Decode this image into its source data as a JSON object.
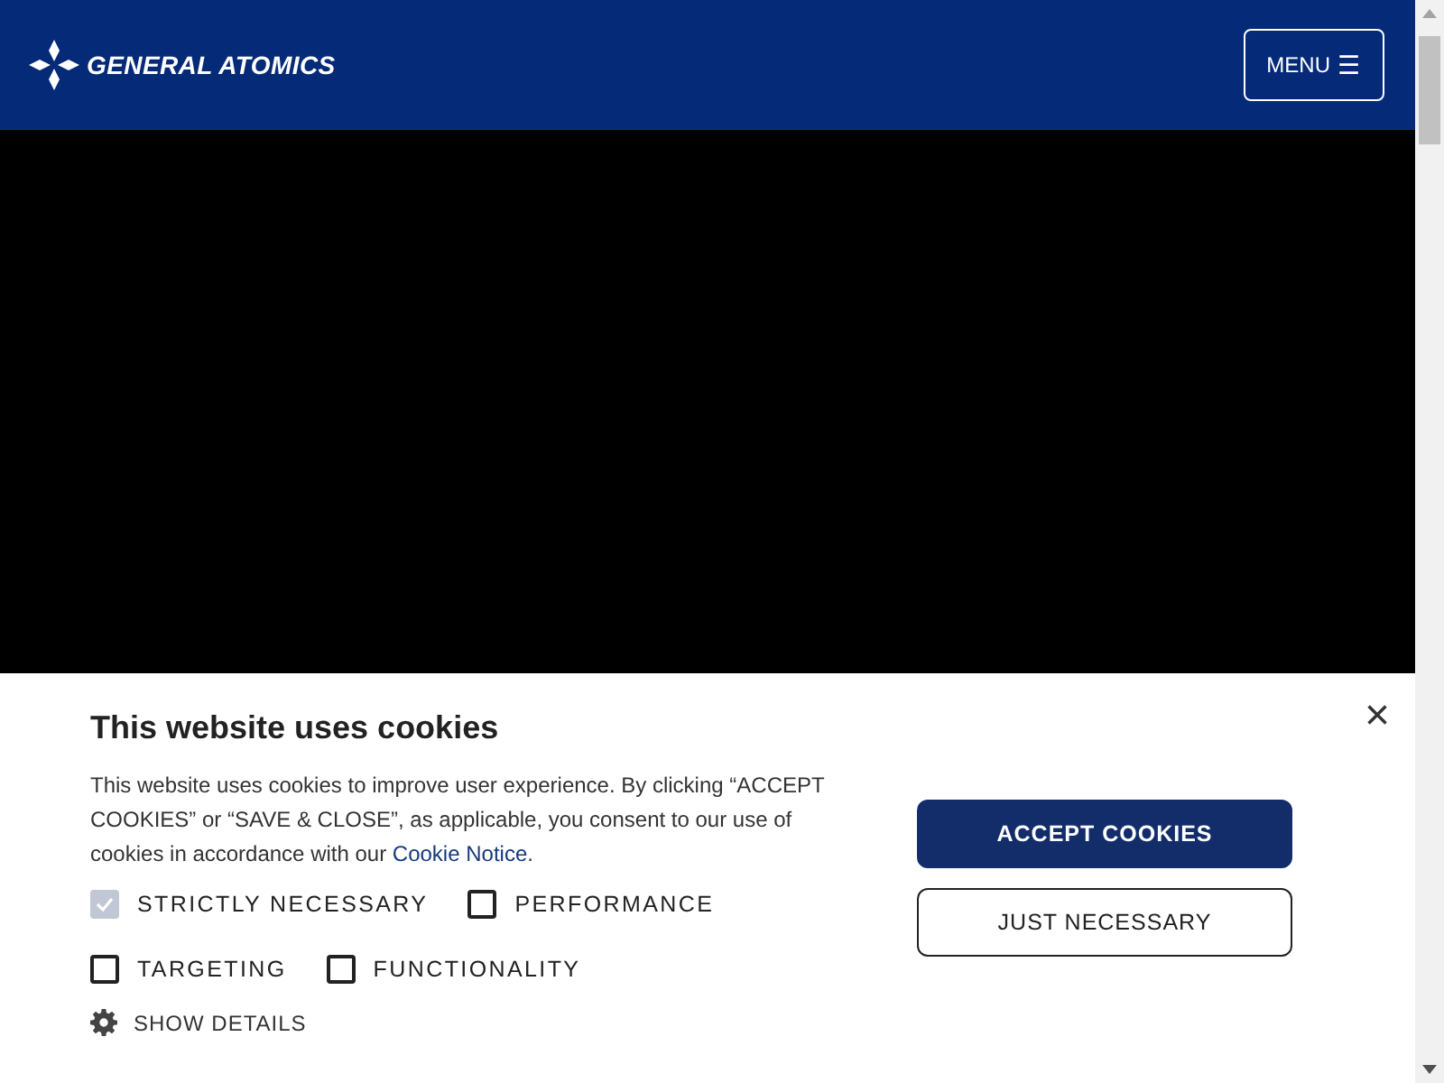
{
  "header": {
    "logo_text": "GENERAL ATOMICS",
    "menu_button": {
      "label": "MENU",
      "icon": "☰"
    }
  },
  "cookie_banner": {
    "title": "This website uses cookies",
    "text": "This website uses cookies to improve user experience. By clicking “ACCEPT COOKIES” or “SAVE & CLOSE”, as applicable, you consent to our use of cookies in accordance with our ",
    "link": "Cookie Notice",
    "text_end": ".",
    "close": "×",
    "checkboxes": [
      {
        "label": "STRICTLY NECESSARY",
        "checked": true,
        "disabled": true
      },
      {
        "label": "PERFORMANCE",
        "checked": false,
        "disabled": false
      },
      {
        "label": "TARGETING",
        "checked": false,
        "disabled": false
      },
      {
        "label": "FUNCTIONALITY",
        "checked": false,
        "disabled": false
      }
    ],
    "show_details": "SHOW DETAILS",
    "buttons": [
      {
        "label": "ACCEPT COOKIES",
        "kind": "primary"
      },
      {
        "label": "JUST NECESSARY",
        "kind": "secondary"
      }
    ]
  }
}
